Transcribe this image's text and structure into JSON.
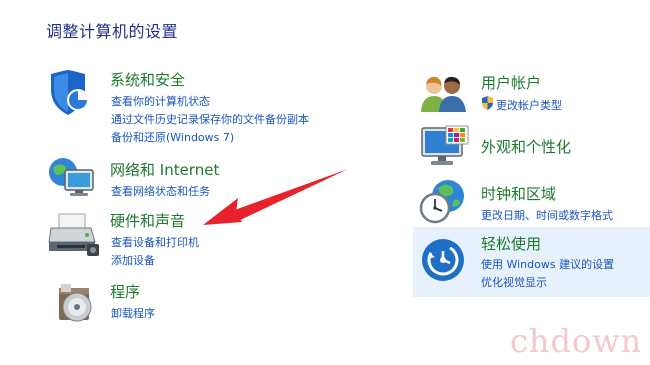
{
  "page": {
    "title": "调整计算机的设置"
  },
  "categories": {
    "system_security": {
      "icon": "shield-icon",
      "title": "系统和安全",
      "links": [
        "查看你的计算机状态",
        "通过文件历史记录保存你的文件备份副本",
        "备份和还原(Windows 7)"
      ]
    },
    "network_internet": {
      "icon": "network-globe-icon",
      "title": "网络和 Internet",
      "links": [
        "查看网络状态和任务"
      ]
    },
    "hardware_sound": {
      "icon": "printer-icon",
      "title": "硬件和声音",
      "links": [
        "查看设备和打印机",
        "添加设备"
      ]
    },
    "programs": {
      "icon": "programs-disc-icon",
      "title": "程序",
      "links": [
        "卸载程序"
      ]
    },
    "user_accounts": {
      "icon": "users-icon",
      "title": "用户帐户",
      "links": [
        "更改帐户类型"
      ]
    },
    "appearance": {
      "icon": "monitor-palette-icon",
      "title": "外观和个性化",
      "links": []
    },
    "clock_region": {
      "icon": "clock-globe-icon",
      "title": "时钟和区域",
      "links": [
        "更改日期、时间或数字格式"
      ]
    },
    "ease_of_access": {
      "icon": "ease-of-access-icon",
      "title": "轻松使用",
      "links": [
        "使用 Windows 建议的设置",
        "优化视觉显示"
      ]
    }
  },
  "annotation": {
    "type": "arrow",
    "target": "查看设备和打印机",
    "color": "#e8212b"
  },
  "watermark": "chdown",
  "colors": {
    "title": "#1e3287",
    "category": "#1e7a2e",
    "link": "#1a55c0",
    "highlight": "#e6f1fb"
  }
}
